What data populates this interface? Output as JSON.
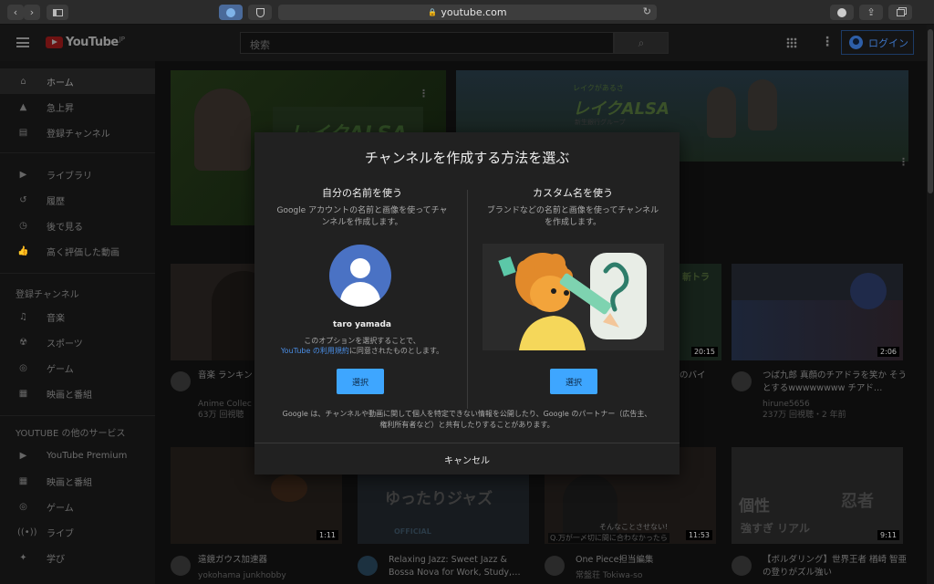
{
  "browser": {
    "url": "youtube.com"
  },
  "header": {
    "logo_text": "YouTube",
    "logo_region": "JP",
    "search_placeholder": "検索",
    "login_label": "ログイン"
  },
  "sidebar": {
    "items": [
      {
        "label": "ホーム",
        "icon": "home-icon"
      },
      {
        "label": "急上昇",
        "icon": "fire-icon"
      },
      {
        "label": "登録チャンネル",
        "icon": "subscriptions-icon"
      }
    ],
    "library_items": [
      {
        "label": "ライブラリ",
        "icon": "library-icon"
      },
      {
        "label": "履歴",
        "icon": "history-icon"
      },
      {
        "label": "後で見る",
        "icon": "clock-icon"
      },
      {
        "label": "高く評価した動画",
        "icon": "thumbs-up-icon"
      }
    ],
    "subs_heading": "登録チャンネル",
    "sub_items": [
      {
        "label": "音楽",
        "icon": "music-icon"
      },
      {
        "label": "スポーツ",
        "icon": "trophy-icon"
      },
      {
        "label": "ゲーム",
        "icon": "gamepad-icon"
      },
      {
        "label": "映画と番組",
        "icon": "film-icon"
      }
    ],
    "more_heading": "YOUTUBE の他のサービス",
    "more_items": [
      {
        "label": "YouTube Premium",
        "icon": "youtube-icon"
      },
      {
        "label": "映画と番組",
        "icon": "film-icon"
      },
      {
        "label": "ゲーム",
        "icon": "gamepad-icon"
      },
      {
        "label": "ライブ",
        "icon": "live-icon"
      },
      {
        "label": "学び",
        "icon": "bulb-icon"
      }
    ]
  },
  "banners": {
    "left_sign": "レイクALSA",
    "right_brand_top": "レイクがあるさ",
    "right_brand": "レイクALSA",
    "right_brand_sub": "新生銀行グループ"
  },
  "videos_row1": [
    {
      "title": "音楽 ランキン 2021 (ベスト",
      "channel": "Anime Collec",
      "meta": "63万 回視聴"
    },
    {
      "title": "",
      "channel": "",
      "meta": "",
      "duration": "20:15",
      "thumb_text": "斬トラ",
      "title_tail": "のバイ"
    },
    {
      "title": "つば九郎 真顔のチアドラを笑か そうとするwwwwwwww チアド…",
      "channel": "hirune5656",
      "meta": "237万 回視聴・2 年前",
      "duration": "2:06"
    }
  ],
  "videos_row2": [
    {
      "title": "遠鏡ガウス加速器",
      "channel": "yokohama junkhobby",
      "duration": "1:11"
    },
    {
      "title": "Relaxing Jazz: Sweet Jazz & Bossa Nova for Work, Study,…",
      "thumb_text": "ゆったりジャズ",
      "thumb_sub": "OFFICIAL"
    },
    {
      "title": "One Piece担当編集",
      "channel": "常盤荘 Tokiwa-so",
      "duration": "11:53",
      "caption1": "そんなことさせない!",
      "caption2": "Q.万が一〆切に間に合わなかったら"
    },
    {
      "title": "【ボルダリング】世界王者 楢崎 智亜 の登りがズル強い",
      "duration": "9:11",
      "thumb_text1": "個性",
      "thumb_text2": "忍者",
      "thumb_text3": "強すぎ リアル"
    }
  ],
  "dialog": {
    "title": "チャンネルを作成する方法を選ぶ",
    "left": {
      "heading": "自分の名前を使う",
      "description": "Google アカウントの名前と画像を使ってチャンネルを作成します。",
      "user_name": "taro yamada",
      "note_line1": "このオプションを選択することで、",
      "note_link": "YouTube の利用規約",
      "note_line2": "に同意されたものとします。",
      "button": "選択"
    },
    "right": {
      "heading": "カスタム名を使う",
      "description": "ブランドなどの名前と画像を使ってチャンネルを作成します。",
      "button": "選択"
    },
    "disclaimer": "Google は、チャンネルや動画に関して個人を特定できない情報を公開したり、Google のパートナー（広告主、権利所有者など）と共有したりすることがあります。",
    "cancel": "キャンセル"
  },
  "colors": {
    "accent": "#3ea6ff",
    "link": "#4a8ee6",
    "dialog_bg": "#212121"
  }
}
